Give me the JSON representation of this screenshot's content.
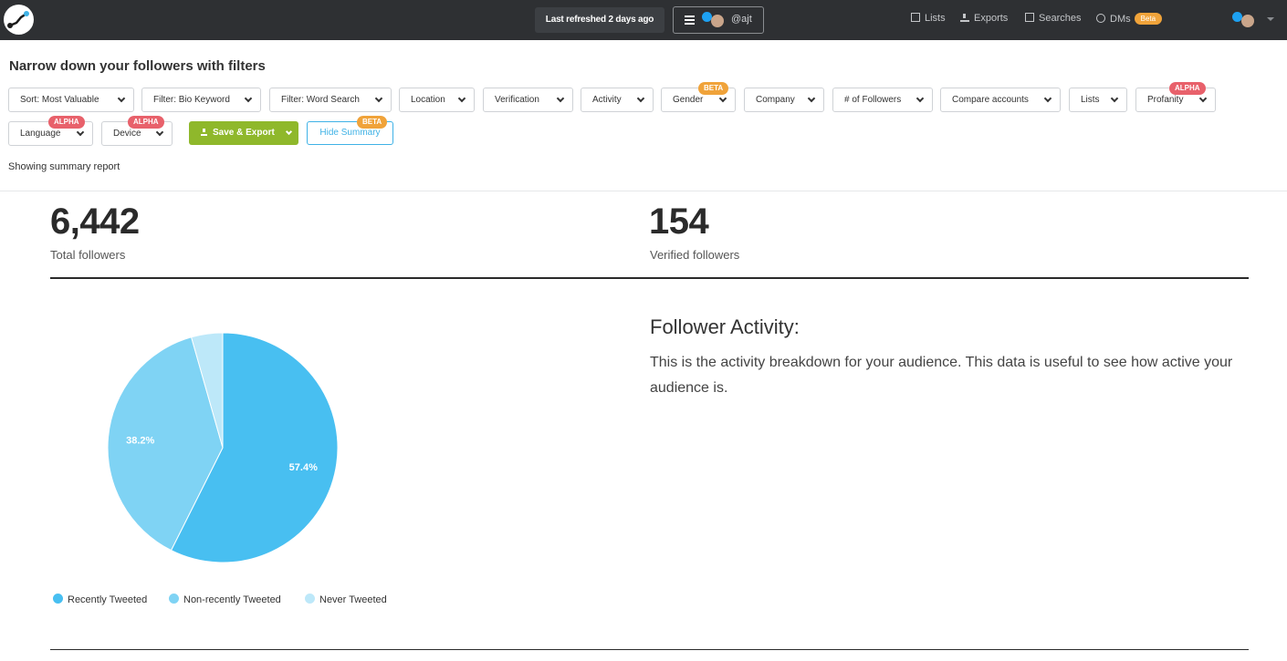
{
  "header": {
    "refresh_text": "Last refreshed 2 days ago",
    "account_handle": "@ajt",
    "nav": [
      {
        "label": "Lists",
        "icon": "list-icon"
      },
      {
        "label": "Exports",
        "icon": "download-icon"
      },
      {
        "label": "Searches",
        "icon": "save-icon"
      },
      {
        "label": "DMs",
        "icon": "chat-icon",
        "badge": "Beta"
      }
    ]
  },
  "filters": {
    "title": "Narrow down your followers with filters",
    "buttons": [
      {
        "label": "Sort: Most Valuable"
      },
      {
        "label": "Filter: Bio Keyword"
      },
      {
        "label": "Filter: Word Search"
      },
      {
        "label": "Location"
      },
      {
        "label": "Verification"
      },
      {
        "label": "Activity"
      },
      {
        "label": "Gender",
        "tag": "BETA"
      },
      {
        "label": "Company"
      },
      {
        "label": "# of Followers"
      },
      {
        "label": "Compare accounts"
      },
      {
        "label": "Lists"
      },
      {
        "label": "Profanity",
        "tag": "ALPHA"
      },
      {
        "label": "Language",
        "tag": "ALPHA"
      },
      {
        "label": "Device",
        "tag": "ALPHA"
      }
    ],
    "save_export": "Save & Export",
    "hide_summary": "Hide Summary",
    "hide_summary_tag": "BETA",
    "showing": "Showing summary report"
  },
  "stats": {
    "total_followers": "6,442",
    "total_followers_label": "Total followers",
    "verified_followers": "154",
    "verified_followers_label": "Verified followers"
  },
  "activity": {
    "title": "Follower Activity:",
    "description": "This is the activity breakdown for your audience. This data is useful to see how active your audience is."
  },
  "colors": {
    "recently": "#48bff1",
    "non_recently": "#7fd3f4",
    "never": "#bde8f9",
    "beta_tag": "#f0a33a",
    "alpha_tag": "#e8616b",
    "save_button": "#8fb82b"
  },
  "chart_data": {
    "type": "pie",
    "slices": [
      {
        "name": "Recently Tweeted",
        "value": 57.4,
        "label": "57.4%"
      },
      {
        "name": "Non-recently Tweeted",
        "value": 38.2,
        "label": "38.2%"
      },
      {
        "name": "Never Tweeted",
        "value": 4.4,
        "label": ""
      }
    ],
    "legend_position": "bottom-left"
  }
}
